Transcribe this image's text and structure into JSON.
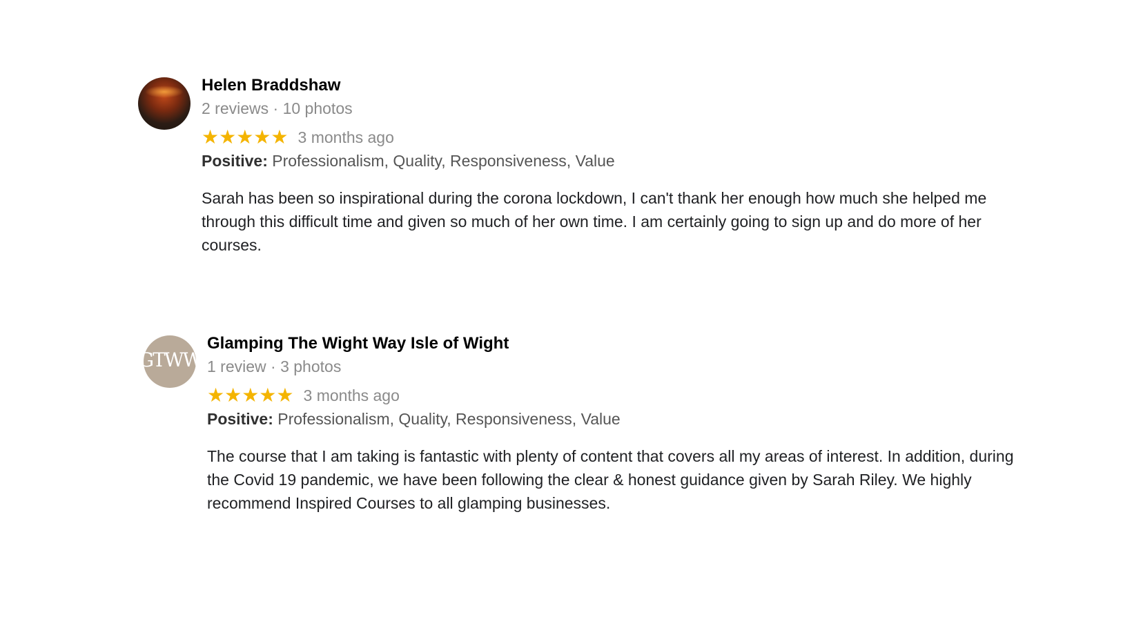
{
  "reviews": [
    {
      "name": "Helen Braddshaw",
      "meta": "2 reviews · 10 photos",
      "stars": "★★★★★",
      "rating": 5,
      "date": "3 months ago",
      "positive_label": "Positive:",
      "positive_values": "Professionalism, Quality, Responsiveness, Value",
      "text": "Sarah has been so inspirational during the corona lockdown, I can't thank her enough how much she helped me through this difficult time and given so much of her own time. I am certainly going to sign up and do more of her courses."
    },
    {
      "name": "Glamping The Wight Way Isle of Wight",
      "meta": "1 review · 3 photos",
      "stars": "★★★★★",
      "rating": 5,
      "date": "3 months ago",
      "positive_label": "Positive:",
      "positive_values": "Professionalism, Quality, Responsiveness, Value",
      "text": "The course that I am taking is fantastic with plenty of content that covers all my areas of interest.  In addition, during the Covid 19 pandemic, we have been following the clear & honest guidance given by Sarah Riley.  We highly recommend Inspired Courses to all glamping businesses.",
      "avatar_logo": "GTWW"
    }
  ],
  "colors": {
    "star": "#f4b400",
    "meta_text": "#8a8a8a",
    "body_text": "#202124",
    "avatar_gtww_bg": "#b9aa99"
  },
  "icons": {
    "avatar_1": "profile-photo",
    "avatar_2": "gtww-logo-avatar",
    "rating": "star-icon"
  }
}
